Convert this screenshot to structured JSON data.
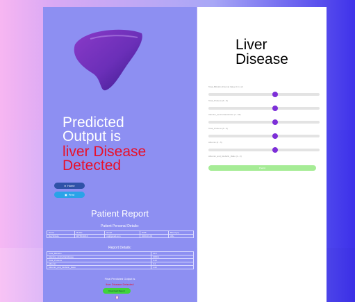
{
  "left": {
    "predicted_line1": "Predicted",
    "predicted_line2": "Output is",
    "result_line1": "liver Disease",
    "result_line2": "Detected",
    "buttons": {
      "home": "Home",
      "print": "Print"
    },
    "patient_report_title": "Patient Report",
    "personal_details_title": "Patient Personal Details:",
    "personal_table": {
      "headers": [
        "Name",
        "Mobile",
        "Email",
        "DOB",
        "Blood grp"
      ],
      "row": [
        "Raj Shinde",
        "9876543210",
        "raj@gmail.com",
        "2000-01-01",
        "AB+"
      ]
    },
    "report_details_title": "Report Details:",
    "report_table": [
      [
        "Total_Bilirubin",
        "10.2"
      ],
      [
        "Alamine_Aminotransferase",
        "1000.1"
      ],
      [
        "Total_Protiens",
        "6.23"
      ],
      [
        "Albumin",
        "3.2"
      ],
      [
        "Albumin_and_Globulin_Ratio",
        "1.02"
      ]
    ],
    "final_label": "Final Predicted Output is",
    "final_value": "liver Disease Detected",
    "download_label": "Download Report"
  },
  "right": {
    "title_line1": "Liver",
    "title_line2": "Disease",
    "sliders": [
      {
        "label": "Total_Bilirubin (Normal Value 0.3-1.2)",
        "value_fraction": 0.5
      },
      {
        "label": "Total_Protiens (6 - 8)",
        "value_fraction": 0.5
      },
      {
        "label": "Alamine_Aminotransferase (7 - 56)",
        "value_fraction": 0.5
      },
      {
        "label": "Total_Protiens (6 - 8)",
        "value_fraction": 0.5
      },
      {
        "label": "Albumin (3 - 5)",
        "value_fraction": 0.5
      },
      {
        "label": "Albumin_and_Globulin_Ratio (1 - 2)",
        "value_fraction": 0.5
      }
    ],
    "predict_label": "Predict"
  }
}
